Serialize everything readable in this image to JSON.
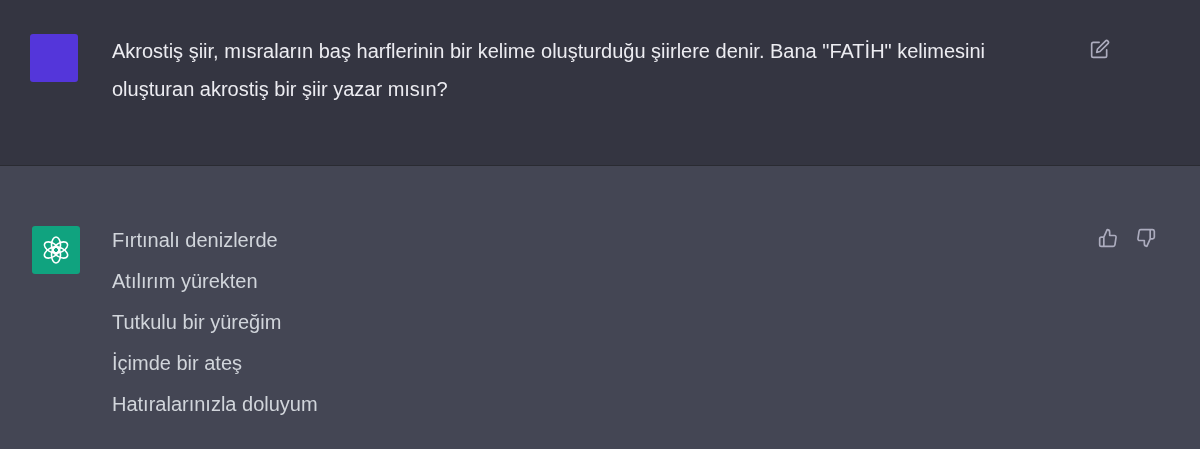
{
  "messages": [
    {
      "kind": "user",
      "text": "Akrostiş şiir, mısraların baş harflerinin bir kelime oluşturduğu şiirlere denir. Bana \"FATİH\" kelimesini oluşturan akrostiş bir şiir yazar mısın?"
    },
    {
      "kind": "assistant",
      "lines": [
        "Fırtınalı denizlerde",
        "Atılırım yürekten",
        "Tutkulu bir yüreğim",
        "İçimde bir ateş",
        "Hatıralarınızla doluyum"
      ]
    }
  ]
}
